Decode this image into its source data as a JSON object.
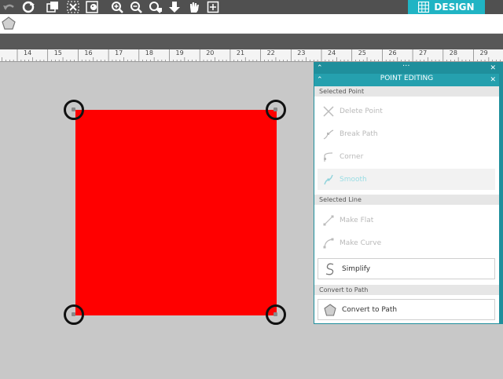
{
  "toolbar": {
    "icons": [
      "undo-icon",
      "redo-icon",
      "group-icon",
      "ungroup-icon",
      "sticky-icon",
      "zoom-in-icon",
      "zoom-out-icon",
      "zoom-fit-icon",
      "move-down-icon",
      "pan-icon",
      "add-page-icon"
    ],
    "design_tab": "DESIGN"
  },
  "ruler": {
    "labels": [
      "14",
      "15",
      "16",
      "17",
      "18",
      "19",
      "20",
      "21",
      "22",
      "23",
      "24",
      "25",
      "26",
      "27",
      "28",
      "29"
    ]
  },
  "canvas": {
    "shape_color": "#ff0000"
  },
  "panel": {
    "title": "POINT EDITING",
    "accent": "#25a0ae",
    "sections": {
      "selected_point": "Selected Point",
      "selected_line": "Selected Line",
      "convert": "Convert to Path"
    },
    "items": {
      "delete_point": "Delete Point",
      "break_path": "Break Path",
      "corner": "Corner",
      "smooth": "Smooth",
      "make_flat": "Make Flat",
      "make_curve": "Make Curve",
      "simplify": "Simplify",
      "convert_to_path": "Convert to Path"
    }
  }
}
